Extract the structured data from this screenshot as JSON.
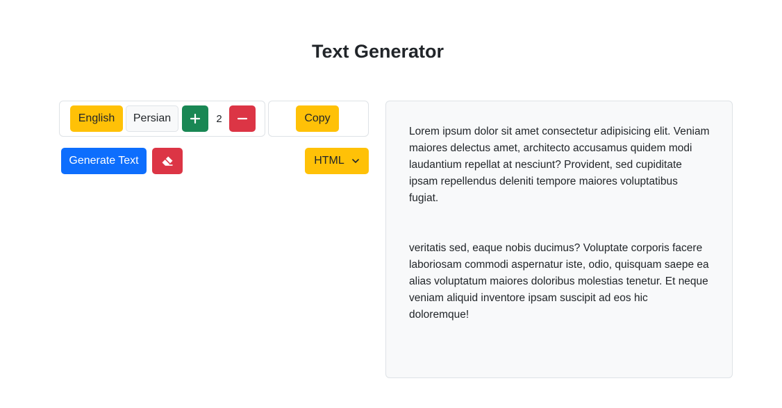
{
  "page": {
    "title": "Text Generator"
  },
  "controls": {
    "language_options": [
      {
        "label": "English",
        "selected": true
      },
      {
        "label": "Persian",
        "selected": false
      }
    ],
    "increment_icon": "plus-icon",
    "decrement_icon": "minus-icon",
    "paragraph_count": "2",
    "copy_label": "Copy",
    "generate_label": "Generate Text",
    "clear_icon": "eraser-icon",
    "format_select": {
      "selected": "HTML",
      "icon": "chevron-down-icon"
    }
  },
  "output": {
    "paragraphs": [
      "Lorem ipsum dolor sit amet consectetur adipisicing elit. Veniam maiores delectus amet, architecto accusamus quidem modi laudantium repellat at nesciunt? Provident, sed cupiditate ipsam repellendus deleniti tempore maiores voluptatibus fugiat.",
      "veritatis sed, eaque nobis ducimus? Voluptate corporis facere laboriosam commodi aspernatur iste, odio, quisquam saepe ea alias voluptatum maiores doloribus molestias tenetur. Et neque veniam aliquid inventore ipsam suscipit ad eos hic doloremque!"
    ]
  },
  "colors": {
    "warning": "#ffc107",
    "light": "#f8f9fa",
    "success": "#198754",
    "danger": "#dc3545",
    "primary": "#0d6efd",
    "panel_bg": "#f8f9fa",
    "border": "#dee2e6"
  }
}
